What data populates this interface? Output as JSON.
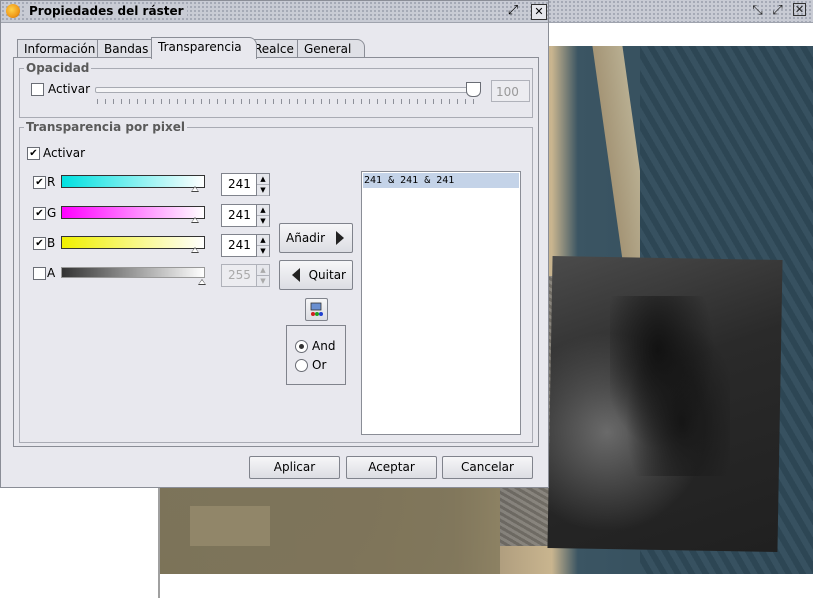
{
  "background_window": {
    "buttons": [
      "minimize-icon",
      "maximize-icon",
      "close-icon"
    ]
  },
  "dialog": {
    "title": "Propiedades del ráster",
    "tabs": [
      "Información",
      "Bandas",
      "Transparencia",
      "Realce",
      "General"
    ],
    "active_tab": "Transparencia"
  },
  "opacity": {
    "group_title": "Opacidad",
    "enable_label": "Activar",
    "enabled": false,
    "value": "100",
    "slider_level": 1.0
  },
  "pixel_transparency": {
    "group_title": "Transparencia por pixel",
    "enable_label": "Activar",
    "enabled": true,
    "bands": [
      {
        "label": "R",
        "checked": true,
        "value": "241",
        "color": "#00e5e5"
      },
      {
        "label": "G",
        "checked": true,
        "value": "241",
        "color": "#ff00ff"
      },
      {
        "label": "B",
        "checked": true,
        "value": "241",
        "color": "#f0f000"
      },
      {
        "label": "A",
        "checked": false,
        "value": "255",
        "color": "#333333"
      }
    ],
    "add_button": "Añadir",
    "remove_button": "Quitar",
    "operator_and": "And",
    "operator_or": "Or",
    "selected_operator": "And",
    "list_items": [
      "241 & 241 & 241"
    ]
  },
  "footer": {
    "apply": "Aplicar",
    "accept": "Aceptar",
    "cancel": "Cancelar"
  }
}
